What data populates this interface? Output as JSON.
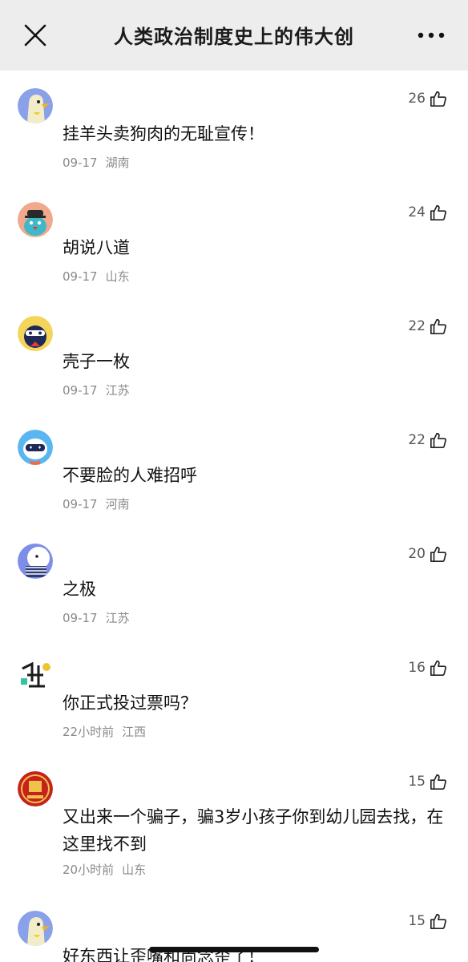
{
  "header": {
    "title": "人类政治制度史上的伟大创",
    "close_icon": "close-icon",
    "more_icon": "more-icon"
  },
  "comments": [
    {
      "text": "挂羊头卖狗肉的无耻宣传！",
      "date": "09-17",
      "region": "湖南",
      "likes": "26",
      "avatar": "duck-yellow"
    },
    {
      "text": "胡说八道",
      "date": "09-17",
      "region": "山东",
      "likes": "24",
      "avatar": "bird-hat"
    },
    {
      "text": "壳子一枚",
      "date": "09-17",
      "region": "江苏",
      "likes": "22",
      "avatar": "penguin-mask"
    },
    {
      "text": "不要脸的人难招呼",
      "date": "09-17",
      "region": "河南",
      "likes": "22",
      "avatar": "robot-cat"
    },
    {
      "text": "之极",
      "date": "09-17",
      "region": "江苏",
      "likes": "20",
      "avatar": "cat-blue"
    },
    {
      "text": "你正式投过票吗？",
      "date": "22小时前",
      "region": "江西",
      "likes": "16",
      "avatar": "chart-icon"
    },
    {
      "text": "又出来一个骗子，骗3岁小孩子你到幼儿园去找，在这里找不到",
      "date": "20小时前",
      "region": "山东",
      "likes": "15",
      "avatar": "red-seal"
    },
    {
      "text": "好东西让歪嘴和尚念歪了！",
      "date": "",
      "region": "",
      "likes": "15",
      "avatar": "duck-yellow"
    }
  ]
}
